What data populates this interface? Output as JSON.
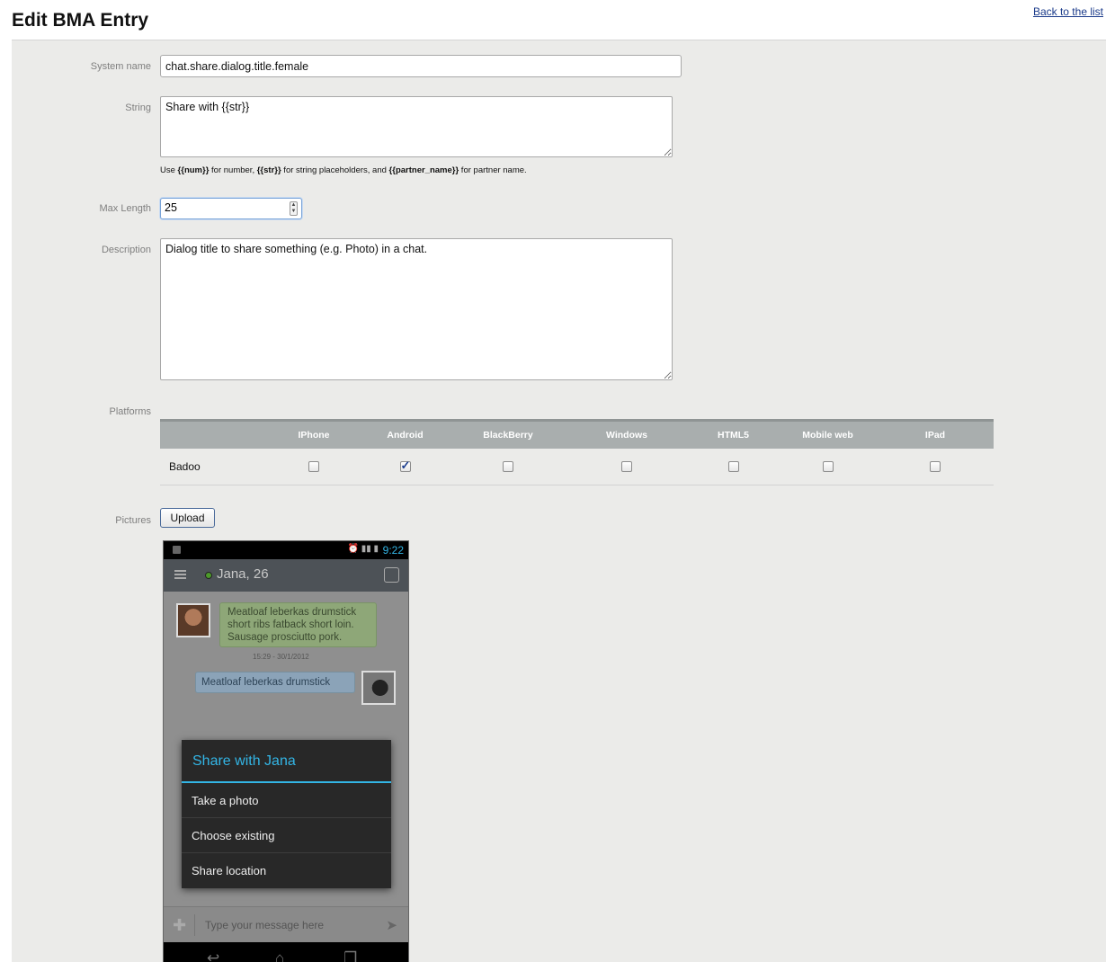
{
  "page": {
    "title": "Edit BMA Entry",
    "back_link": "Back to the list"
  },
  "form": {
    "system_name": {
      "label": "System name",
      "value": "chat.share.dialog.title.female"
    },
    "string": {
      "label": "String",
      "value": "Share with {{str}}",
      "hint_parts": [
        "Use ",
        "{{num}}",
        " for number, ",
        "{{str}}",
        " for string placeholders, and ",
        "{{partner_name}}",
        " for partner name."
      ]
    },
    "max_length": {
      "label": "Max Length",
      "value": "25"
    },
    "description": {
      "label": "Description",
      "value": "Dialog title to share something (e.g. Photo) in a chat."
    },
    "platforms": {
      "label": "Platforms",
      "columns": [
        "IPhone",
        "Android",
        "BlackBerry",
        "Windows",
        "HTML5",
        "Mobile web",
        "IPad"
      ],
      "rows": [
        {
          "app": "Badoo",
          "checked": [
            false,
            true,
            false,
            false,
            false,
            false,
            false
          ]
        }
      ]
    },
    "pictures": {
      "label": "Pictures",
      "upload_label": "Upload"
    }
  },
  "phone_screenshot": {
    "status_time": "9:22",
    "chat_partner": "Jana, 26",
    "message1": "Meatloaf leberkas drumstick short ribs fatback short loin. Sausage prosciutto pork.",
    "message1_time": "15:29 - 30/1/2012",
    "message2": "Meatloaf leberkas drumstick",
    "dialog_title": "Share with Jana",
    "dialog_items": [
      "Take a photo",
      "Choose existing",
      "Share location"
    ],
    "input_placeholder": "Type your message here",
    "accent_color": "#33b5e5"
  }
}
